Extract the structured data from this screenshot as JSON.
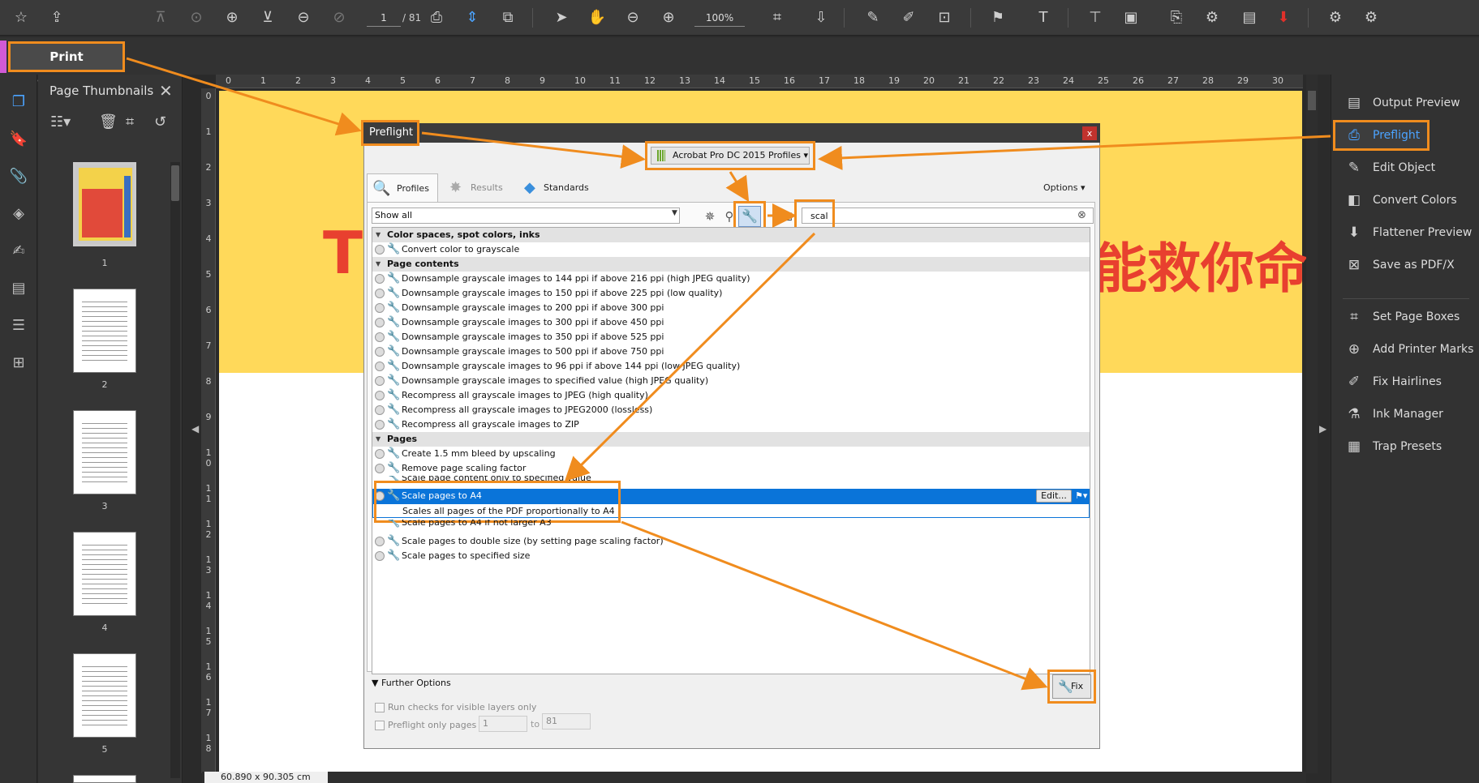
{
  "toolbar": {
    "page_current": "1",
    "page_total": "/ 81",
    "zoom": "100%"
  },
  "tool_tab": {
    "label": "Print Production"
  },
  "thumbnails": {
    "title": "Page Thumbnails",
    "labels": [
      "1",
      "2",
      "3",
      "4",
      "5"
    ]
  },
  "ruler": {
    "top": [
      "0",
      "1",
      "2",
      "3",
      "4",
      "5",
      "6",
      "7",
      "8",
      "9",
      "10",
      "11",
      "12",
      "13",
      "14",
      "15",
      "16",
      "17",
      "18",
      "19",
      "20",
      "21",
      "22",
      "23",
      "24",
      "25",
      "26",
      "27",
      "28",
      "29",
      "30"
    ],
    "left": [
      "0",
      "1",
      "2",
      "3",
      "4",
      "5",
      "6",
      "7",
      "8",
      "9",
      "1 0",
      "1 1",
      "1 2",
      "1 3",
      "1 4",
      "1 5",
      "1 6",
      "1 7",
      "1 8"
    ]
  },
  "page": {
    "text_left": "T",
    "text_right": "能救你命",
    "size": "60.890 x 90.305 cm"
  },
  "right_panel": {
    "items": [
      "Output Preview",
      "Preflight",
      "Edit Object",
      "Convert Colors",
      "Flattener Preview",
      "Save as PDF/X",
      "Set Page Boxes",
      "Add Printer Marks",
      "Fix Hairlines",
      "Ink Manager",
      "Trap Presets"
    ]
  },
  "dialog": {
    "title": "Preflight",
    "close": "x",
    "profiles_dropdown": "Acrobat Pro DC 2015 Profiles",
    "tabs": {
      "profiles": "Profiles",
      "results": "Results",
      "standards": "Standards",
      "options": "Options"
    },
    "filter": "Show all",
    "search": "scal",
    "categories": {
      "color": "Color spaces, spot colors, inks",
      "page_contents": "Page contents",
      "pages": "Pages"
    },
    "items_color": [
      "Convert color to grayscale"
    ],
    "items_page_contents": [
      "Downsample grayscale images to 144 ppi if above 216 ppi (high JPEG quality)",
      "Downsample grayscale images to 150 ppi if above 225 ppi (low quality)",
      "Downsample grayscale images to 200 ppi if above 300 ppi",
      "Downsample grayscale images to 300 ppi if above 450 ppi",
      "Downsample grayscale images to 350 ppi if above 525 ppi",
      "Downsample grayscale images to 500 ppi if above 750 ppi",
      "Downsample grayscale images to 96 ppi if above 144 ppi (low JPEG quality)",
      "Downsample grayscale images to specified value (high JPEG quality)",
      "Recompress all grayscale images to JPEG (high quality)",
      "Recompress all grayscale images to JPEG2000 (lossless)",
      "Recompress all grayscale images to ZIP"
    ],
    "items_pages": [
      "Create 1.5 mm bleed by upscaling",
      "Remove page scaling factor",
      "Scale page content only to specified value",
      "Scale pages to A4",
      "Scale pages to A4 if not larger A3",
      "Scale pages to double size (by setting page scaling factor)",
      "Scale pages to specified size"
    ],
    "selected_desc": "Scales all pages of the PDF proportionally to A4",
    "edit": "Edit...",
    "further_options": "Further Options",
    "run_checks": "Run checks for visible layers only",
    "preflight_only": "Preflight only pages",
    "page_from": "1",
    "to": "to",
    "page_to": "81",
    "fix": "Fix"
  },
  "colors": {
    "accent": "#f08c1e",
    "selection": "#0a74d9",
    "banner": "#ffd95a",
    "big_text": "#e8402f"
  }
}
